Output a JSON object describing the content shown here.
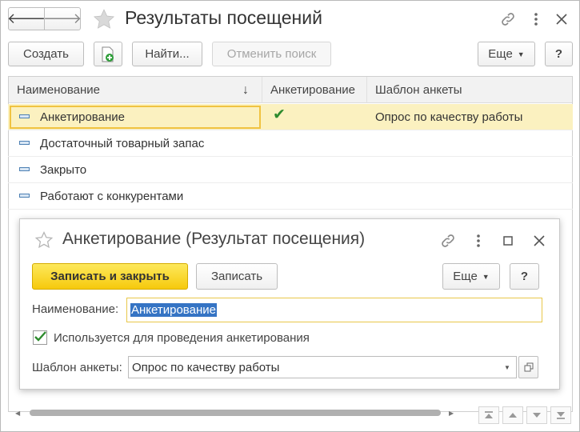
{
  "window": {
    "title": "Результаты посещений",
    "back_glyph": "🡐",
    "forward_glyph": "🡒"
  },
  "toolbar": {
    "create_label": "Создать",
    "find_label": "Найти...",
    "cancel_search_label": "Отменить поиск",
    "more_label": "Еще",
    "help_label": "?"
  },
  "table": {
    "columns": [
      "Наименование",
      "Анкетирование",
      "Шаблон анкеты"
    ],
    "sort_glyph": "↓",
    "rows": [
      {
        "name": "Анкетирование",
        "survey": "✔",
        "template": "Опрос по качеству работы"
      },
      {
        "name": "Достаточный товарный запас",
        "survey": "",
        "template": ""
      },
      {
        "name": "Закрыто",
        "survey": "",
        "template": ""
      },
      {
        "name": "Работают с конкурентами",
        "survey": "",
        "template": ""
      }
    ]
  },
  "dialog": {
    "title": "Анкетирование (Результат посещения)",
    "save_close_label": "Записать и закрыть",
    "save_label": "Записать",
    "more_label": "Еще",
    "help_label": "?",
    "name_label": "Наименование:",
    "name_value": "Анкетирование",
    "checkbox_label": "Используется для проведения анкетирования",
    "checkbox_checked": true,
    "template_label": "Шаблон анкеты:",
    "template_value": "Опрос по качеству работы"
  },
  "colors": {
    "accent_yellow": "#f6c90c",
    "selection": "#fbf1c0",
    "check_green": "#2e8b2e"
  }
}
